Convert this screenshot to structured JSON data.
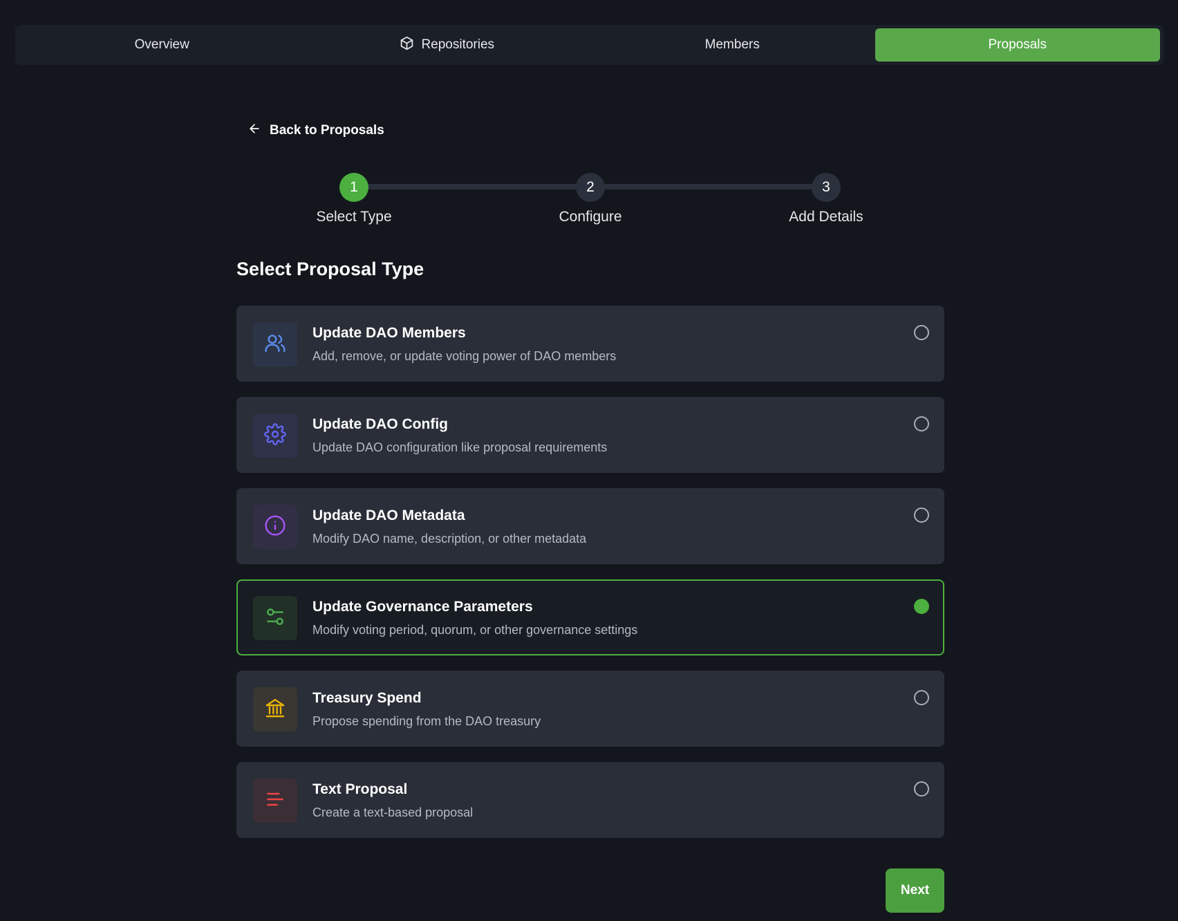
{
  "tabs": [
    {
      "label": "Overview",
      "icon": "",
      "active": false
    },
    {
      "label": "Repositories",
      "icon": "package-icon",
      "active": false
    },
    {
      "label": "Members",
      "icon": "",
      "active": false
    },
    {
      "label": "Proposals",
      "icon": "",
      "active": true
    }
  ],
  "back_link": {
    "label": "Back to Proposals",
    "icon": "arrow-left-icon"
  },
  "stepper": {
    "steps": [
      {
        "number": "1",
        "label": "Select Type",
        "active": true
      },
      {
        "number": "2",
        "label": "Configure",
        "active": false
      },
      {
        "number": "3",
        "label": "Add Details",
        "active": false
      }
    ]
  },
  "section_title": "Select Proposal Type",
  "options": [
    {
      "title": "Update DAO Members",
      "description": "Add, remove, or update voting power of DAO members",
      "icon": "users-icon",
      "icon_color": "#5b8def",
      "icon_bg": "#2c3447",
      "selected": false
    },
    {
      "title": "Update DAO Config",
      "description": "Update DAO configuration like proposal requirements",
      "icon": "gear-icon",
      "icon_color": "#6366f1",
      "icon_bg": "#2e3148",
      "selected": false
    },
    {
      "title": "Update DAO Metadata",
      "description": "Modify DAO name, description, or other metadata",
      "icon": "info-icon",
      "icon_color": "#a855f7",
      "icon_bg": "#322e45",
      "selected": false
    },
    {
      "title": "Update Governance Parameters",
      "description": "Modify voting period, quorum, or other governance settings",
      "icon": "sliders-icon",
      "icon_color": "#4caf50",
      "icon_bg": "#223127",
      "selected": true
    },
    {
      "title": "Treasury Spend",
      "description": "Propose spending from the DAO treasury",
      "icon": "bank-icon",
      "icon_color": "#eab308",
      "icon_bg": "#3a3631",
      "selected": false
    },
    {
      "title": "Text Proposal",
      "description": "Create a text-based proposal",
      "icon": "text-lines-icon",
      "icon_color": "#ef4444",
      "icon_bg": "#3b2e35",
      "selected": false
    }
  ],
  "next_button": {
    "label": "Next"
  },
  "colors": {
    "accent": "#4caf3f",
    "background": "#13161c",
    "card": "#292e38"
  }
}
